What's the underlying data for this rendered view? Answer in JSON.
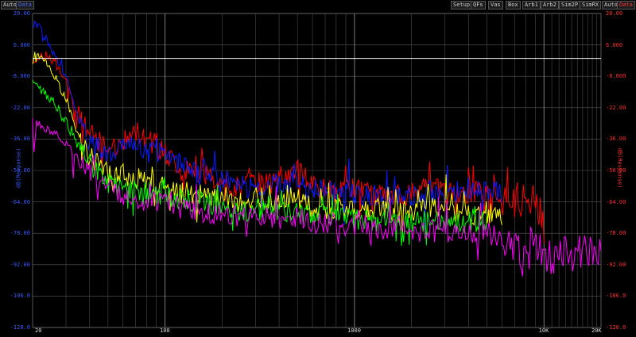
{
  "toolbar": {
    "left_buttons": [
      {
        "label": "Auto",
        "color": "#cfcfcf"
      },
      {
        "label": "Data",
        "color": "#4a6cff"
      }
    ],
    "right_buttons": [
      "Setup",
      "QFs",
      "Vas",
      "Box",
      "Arb1",
      "Arb2",
      "Sim2P",
      "SimRX"
    ],
    "right_axis_buttons": [
      {
        "label": "Auto",
        "color": "#cfcfcf"
      },
      {
        "label": "Data",
        "color": "#ff3a3a"
      }
    ]
  },
  "chart_data": {
    "type": "line",
    "xlabel": "",
    "ylabel_left": "dB(Response)",
    "ylabel_right": "dB(Response)",
    "x_scale": "log",
    "xlim": [
      20,
      20000
    ],
    "ylim": [
      -120,
      20
    ],
    "grid": true,
    "x_tick_labels": [
      "20",
      "100",
      "1000",
      "10K",
      "20K"
    ],
    "y_tick_labels_left": [
      "20.00",
      "6.000",
      "-8.000",
      "-22.00",
      "-36.00",
      "-50.00",
      "-64.00",
      "-78.00",
      "-92.00",
      "-106.0",
      "-120.0"
    ],
    "y_tick_labels_right": [
      "20.00",
      "6.000",
      "-8.000",
      "-22.00",
      "-36.00",
      "-50.00",
      "-64.00",
      "-78.00",
      "-92.00",
      "-106.0",
      "-120.0"
    ],
    "reference_line": {
      "y": 0,
      "color": "#ffffff"
    },
    "series": [
      {
        "color": "#ff0000",
        "x": [
          20,
          22,
          25,
          30,
          35,
          40,
          45,
          50,
          55,
          60,
          70,
          80,
          90,
          100,
          120,
          150,
          200,
          250,
          300,
          350,
          400,
          500,
          600,
          800,
          1000,
          1500,
          2000,
          2500,
          3000,
          4000,
          5000,
          6000,
          7000,
          8000,
          9000,
          10000
        ],
        "y": [
          -2,
          1,
          0,
          -10,
          -25,
          -33,
          -37,
          -40,
          -39,
          -37,
          -32,
          -35,
          -40,
          -42,
          -48,
          -52,
          -56,
          -57,
          -55,
          -56,
          -54,
          -50,
          -57,
          -60,
          -58,
          -62,
          -60,
          -57,
          -60,
          -61,
          -58,
          -62,
          -63,
          -63,
          -60,
          -75
        ]
      },
      {
        "color": "#0a1bff",
        "x": [
          20,
          22,
          25,
          30,
          35,
          40,
          45,
          50,
          55,
          60,
          70,
          80,
          90,
          100,
          120,
          150,
          200,
          250,
          300,
          350,
          400,
          500,
          600,
          800,
          1000,
          1500,
          2000,
          2500,
          3000,
          4000,
          5000,
          6000
        ],
        "y": [
          16,
          14,
          5,
          -8,
          -27,
          -37,
          -40,
          -43,
          -40,
          -38,
          -38,
          -42,
          -41,
          -43,
          -47,
          -52,
          -54,
          -57,
          -58,
          -57,
          -55,
          -55,
          -58,
          -60,
          -60,
          -62,
          -62,
          -59,
          -60,
          -58,
          -59,
          -60
        ]
      },
      {
        "color": "#ffff00",
        "x": [
          20,
          22,
          25,
          30,
          35,
          40,
          45,
          50,
          55,
          60,
          70,
          80,
          90,
          100,
          120,
          150,
          200,
          250,
          300,
          350,
          400,
          500,
          600,
          800,
          1000,
          1500,
          2000,
          2500,
          3000,
          4000,
          5000,
          6000
        ],
        "y": [
          -2,
          2,
          -5,
          -18,
          -35,
          -44,
          -48,
          -51,
          -52,
          -52,
          -53,
          -55,
          -57,
          -58,
          -60,
          -62,
          -63,
          -64,
          -62,
          -63,
          -63,
          -62,
          -66,
          -67,
          -68,
          -68,
          -68,
          -66,
          -68,
          -69,
          -70,
          -70
        ]
      },
      {
        "color": "#00ff00",
        "x": [
          20,
          22,
          25,
          30,
          35,
          40,
          45,
          50,
          55,
          60,
          70,
          80,
          90,
          100,
          120,
          150,
          200,
          250,
          300,
          350,
          400,
          500,
          600,
          800,
          1000,
          1500,
          2000,
          2500,
          3000,
          4000,
          5000
        ],
        "y": [
          -10,
          -14,
          -18,
          -28,
          -40,
          -47,
          -52,
          -55,
          -57,
          -57,
          -58,
          -60,
          -61,
          -62,
          -63,
          -64,
          -66,
          -68,
          -68,
          -66,
          -69,
          -68,
          -70,
          -71,
          -72,
          -72,
          -73,
          -72,
          -72,
          -73,
          -72
        ]
      },
      {
        "color": "#ff00ff",
        "x": [
          20,
          22,
          25,
          30,
          35,
          40,
          45,
          50,
          55,
          60,
          70,
          80,
          90,
          100,
          120,
          150,
          200,
          250,
          300,
          350,
          400,
          500,
          600,
          800,
          1000,
          1500,
          2000,
          2500,
          3000,
          4000,
          5000,
          6000,
          7000,
          8000,
          9000,
          10000,
          12000,
          15000,
          18000,
          20000
        ],
        "y": [
          -28,
          -30,
          -32,
          -38,
          -45,
          -50,
          -55,
          -58,
          -60,
          -61,
          -62,
          -63,
          -64,
          -65,
          -67,
          -68,
          -70,
          -70,
          -71,
          -70,
          -72,
          -71,
          -73,
          -74,
          -74,
          -76,
          -77,
          -77,
          -77,
          -78,
          -78,
          -80,
          -86,
          -90,
          -84,
          -88,
          -87,
          -88,
          -86,
          -82
        ]
      }
    ]
  }
}
